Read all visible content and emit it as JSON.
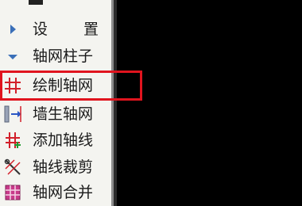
{
  "panel": {
    "items": [
      {
        "label_a": "设",
        "label_b": "置",
        "icon": "triangle-right-icon"
      },
      {
        "label": "轴网柱子",
        "icon": "triangle-down-icon"
      },
      {
        "label": "绘制轴网",
        "icon": "grid-hash-icon"
      },
      {
        "label": "墙生轴网",
        "icon": "wall-to-axis-icon"
      },
      {
        "label": "添加轴线",
        "icon": "add-axis-icon"
      },
      {
        "label": "轴线裁剪",
        "icon": "axis-trim-icon"
      },
      {
        "label": "轴网合并",
        "icon": "axis-merge-icon"
      }
    ]
  },
  "colors": {
    "highlight": "#e0141e",
    "background": "#000000",
    "panel": "#f4f4f0"
  }
}
